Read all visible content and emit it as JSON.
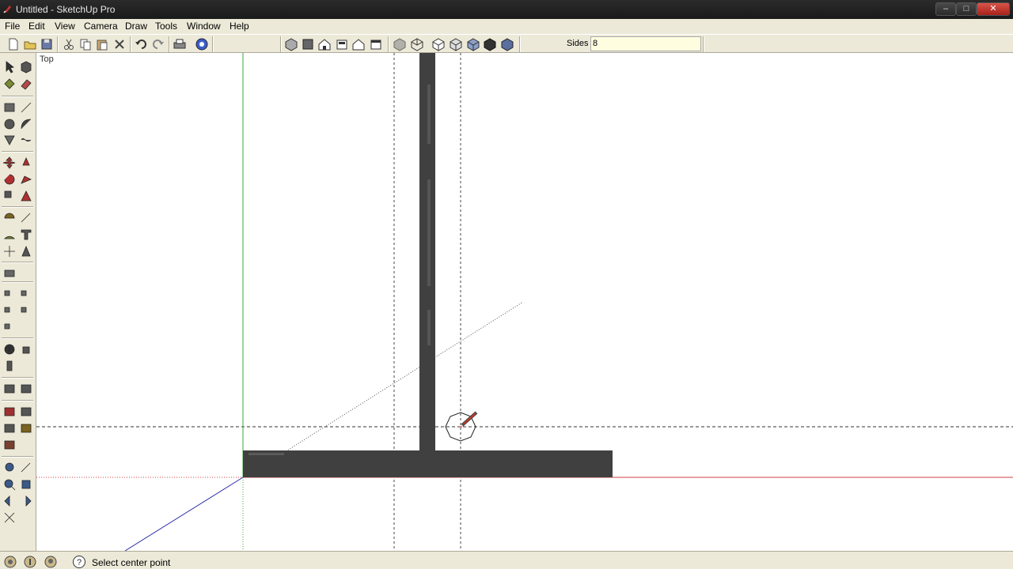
{
  "window": {
    "title": "Untitled - SketchUp Pro",
    "controls": {
      "minimize": "–",
      "maximize": "□",
      "close": "✕"
    }
  },
  "menubar": {
    "items": [
      "File",
      "Edit",
      "View",
      "Camera",
      "Draw",
      "Tools",
      "Window",
      "Help"
    ]
  },
  "toolbar": {
    "icons": [
      "new-icon",
      "open-icon",
      "save-icon",
      "cut-icon",
      "copy-icon",
      "paste-icon",
      "erase-icon",
      "undo-icon",
      "redo-icon",
      "print-icon",
      "model-info-icon",
      "iso-view-icon",
      "top-view-icon",
      "front-view-icon",
      "right-view-icon",
      "back-view-icon",
      "left-view-icon",
      "xray-icon",
      "wireframe-icon",
      "hidden-line-icon",
      "shaded-icon",
      "shaded-textures-icon",
      "monochrome-icon"
    ],
    "vcb_label": "Sides",
    "vcb_value": "8"
  },
  "viewport": {
    "view_label": "Top"
  },
  "statusbar": {
    "icons": [
      "geo-location-icon",
      "credits-icon",
      "user-icon",
      "help-icon"
    ],
    "message": "Select center point"
  },
  "colors": {
    "model_face": "#404040",
    "red_axis": "#d04040",
    "green_axis": "#3aa83a",
    "blue_axis": "#2a2aa8",
    "titlebar": "#1f1f1f",
    "chrome": "#ece9d8"
  }
}
